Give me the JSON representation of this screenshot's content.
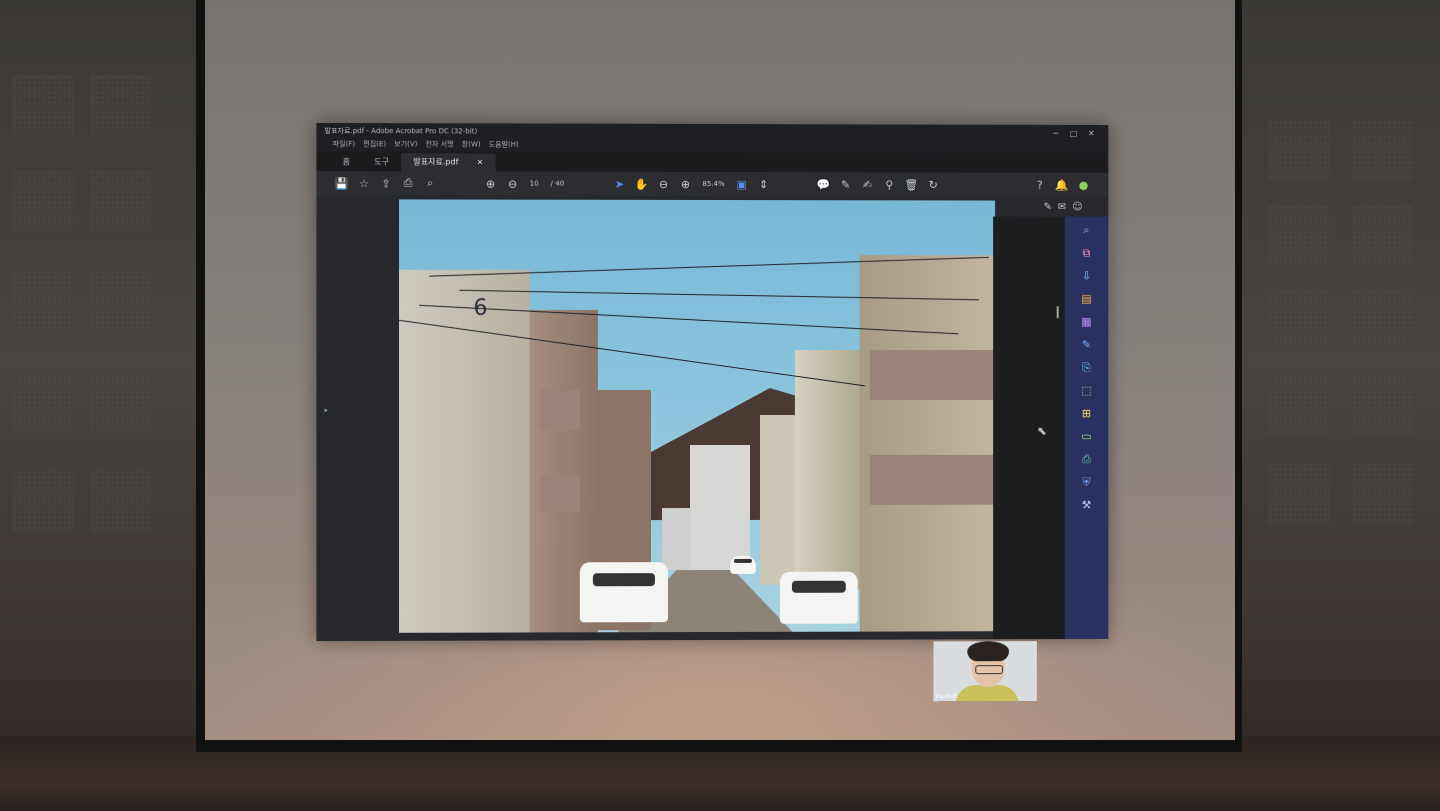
{
  "window": {
    "title": "발표자료.pdf - Adobe Acrobat Pro DC (32-bit)",
    "controls": {
      "minimize": "─",
      "maximize": "□",
      "close": "✕"
    }
  },
  "menu": [
    "파일(F)",
    "편집(E)",
    "보기(V)",
    "전자 서명",
    "창(W)",
    "도움말(H)"
  ],
  "tabs": {
    "home": "홈",
    "tools": "도구",
    "document": "발표자료.pdf",
    "close": "×"
  },
  "toolbar": {
    "page_current": "10",
    "page_total": "/ 40",
    "zoom": "85.4%"
  },
  "icons": {
    "save": "💾",
    "bookmark": "☆",
    "upload": "⇪",
    "print": "⎙",
    "search": "⌕",
    "page_up": "⊕",
    "page_down": "⊖",
    "select": "➤",
    "hand": "✋",
    "zoom_out": "⊖",
    "zoom_in": "⊕",
    "fit": "▣",
    "scroll": "⇕",
    "comment": "💬",
    "pen": "✎",
    "sign": "✍",
    "stamp": "⚲",
    "trash": "🗑",
    "rotate": "↻",
    "help": "?",
    "bell": "🔔",
    "user": "●",
    "edit_pdf": "✎",
    "mail": "✉",
    "account": "☺"
  },
  "right_panel": [
    "⌕",
    "⧉",
    "⇩",
    "▤",
    "▦",
    "✎",
    "⎘",
    "⬚",
    "⊞",
    "▭",
    "⎙",
    "⛨",
    "⚒"
  ],
  "right_panel_colors": [
    "#9fb4ff",
    "#ff8fb2",
    "#6fd3ff",
    "#ffb347",
    "#c08bff",
    "#7fb8ff",
    "#6ad1ff",
    "#8fe36a",
    "#ffe066",
    "#9bea6e",
    "#5fd39c",
    "#7ea8ff",
    "#c5c9ff"
  ],
  "slide": {
    "building_number": "6"
  },
  "webcam": {
    "label": "Ira-Hull"
  },
  "colors": {
    "acrobat_dark": "#1e1f22",
    "panel_blue": "#2a3160",
    "accent": "#5a8df0"
  }
}
